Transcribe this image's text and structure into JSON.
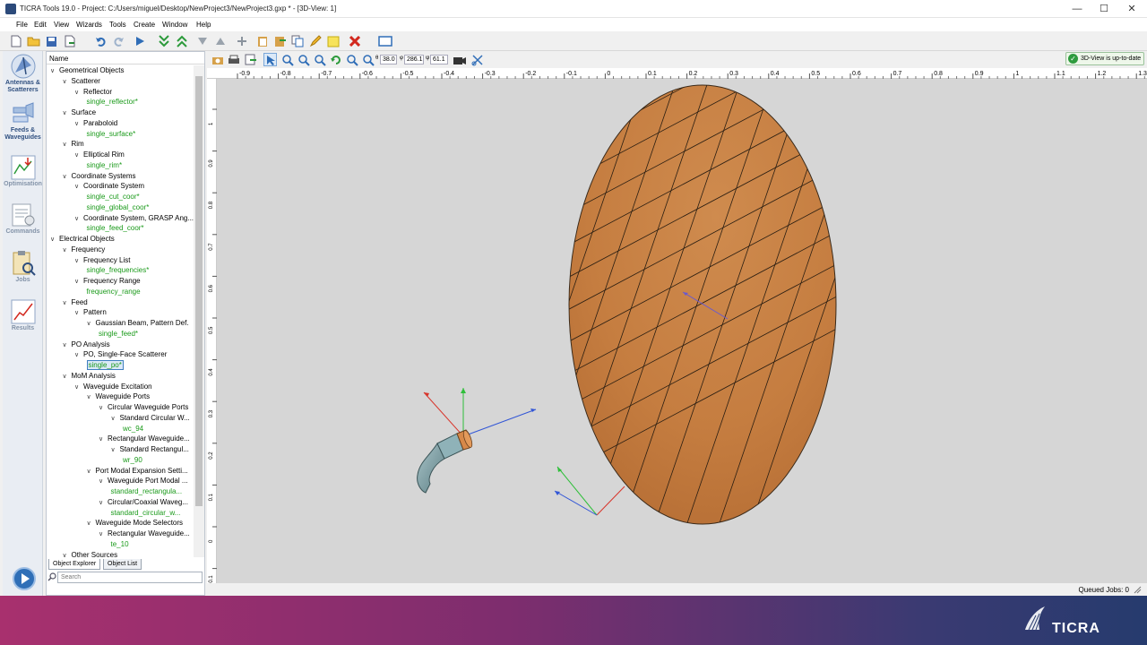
{
  "window": {
    "title": "TICRA Tools 19.0  - Project: C:/Users/miguel/Desktop/NewProject3/NewProject3.gxp * - [3D-View: 1]"
  },
  "menu": [
    "File",
    "Edit",
    "View",
    "Wizards",
    "Tools",
    "Create",
    "Window",
    "Help"
  ],
  "sidebar": [
    {
      "label": "Antennas & Scatterers",
      "icon": "antenna-icon"
    },
    {
      "label": "Feeds & Waveguides",
      "icon": "feed-icon"
    },
    {
      "label": "Optimisation",
      "icon": "optimisation-icon"
    },
    {
      "label": "Commands",
      "icon": "commands-icon"
    },
    {
      "label": "Jobs",
      "icon": "jobs-icon"
    },
    {
      "label": "Results",
      "icon": "results-icon"
    }
  ],
  "explorer": {
    "header": "Name",
    "tree": [
      {
        "text": "Geometrical Objects",
        "level": 0,
        "chev": true
      },
      {
        "text": "Scatterer",
        "level": 1,
        "chev": true
      },
      {
        "text": "Reflector",
        "level": 2,
        "chev": true
      },
      {
        "text": "single_reflector*",
        "level": 3,
        "leaf": true
      },
      {
        "text": "Surface",
        "level": 1,
        "chev": true
      },
      {
        "text": "Paraboloid",
        "level": 2,
        "chev": true
      },
      {
        "text": "single_surface*",
        "level": 3,
        "leaf": true
      },
      {
        "text": "Rim",
        "level": 1,
        "chev": true
      },
      {
        "text": "Elliptical Rim",
        "level": 2,
        "chev": true
      },
      {
        "text": "single_rim*",
        "level": 3,
        "leaf": true
      },
      {
        "text": "Coordinate Systems",
        "level": 1,
        "chev": true
      },
      {
        "text": "Coordinate System",
        "level": 2,
        "chev": true
      },
      {
        "text": "single_cut_coor*",
        "level": 3,
        "leaf": true
      },
      {
        "text": "single_global_coor*",
        "level": 3,
        "leaf": true
      },
      {
        "text": "Coordinate System, GRASP Ang...",
        "level": 2,
        "chev": true
      },
      {
        "text": "single_feed_coor*",
        "level": 3,
        "leaf": true
      },
      {
        "text": "Electrical Objects",
        "level": 0,
        "chev": true
      },
      {
        "text": "Frequency",
        "level": 1,
        "chev": true
      },
      {
        "text": "Frequency List",
        "level": 2,
        "chev": true
      },
      {
        "text": "single_frequencies*",
        "level": 3,
        "leaf": true
      },
      {
        "text": "Frequency Range",
        "level": 2,
        "chev": true
      },
      {
        "text": "frequency_range",
        "level": 3,
        "leaf": true
      },
      {
        "text": "Feed",
        "level": 1,
        "chev": true
      },
      {
        "text": "Pattern",
        "level": 2,
        "chev": true
      },
      {
        "text": "Gaussian Beam, Pattern Def.",
        "level": 3,
        "chev": true
      },
      {
        "text": "single_feed*",
        "level": 4,
        "leaf": true
      },
      {
        "text": "PO Analysis",
        "level": 1,
        "chev": true
      },
      {
        "text": "PO, Single-Face Scatterer",
        "level": 2,
        "chev": true
      },
      {
        "text": "single_po*",
        "level": 3,
        "leaf": true,
        "selected": true
      },
      {
        "text": "MoM Analysis",
        "level": 1,
        "chev": true
      },
      {
        "text": "Waveguide Excitation",
        "level": 2,
        "chev": true
      },
      {
        "text": "Waveguide Ports",
        "level": 3,
        "chev": true
      },
      {
        "text": "Circular Waveguide Ports",
        "level": 4,
        "chev": true
      },
      {
        "text": "Standard Circular W...",
        "level": 5,
        "chev": true
      },
      {
        "text": "wc_94",
        "level": 6,
        "leaf": true
      },
      {
        "text": "Rectangular Waveguide...",
        "level": 4,
        "chev": true
      },
      {
        "text": "Standard Rectangul...",
        "level": 5,
        "chev": true
      },
      {
        "text": "wr_90",
        "level": 6,
        "leaf": true
      },
      {
        "text": "Port Modal Expansion Setti...",
        "level": 3,
        "chev": true
      },
      {
        "text": "Waveguide Port Modal ...",
        "level": 4,
        "chev": true
      },
      {
        "text": "standard_rectangula...",
        "level": 5,
        "leaf": true
      },
      {
        "text": "Circular/Coaxial Waveg...",
        "level": 4,
        "chev": true
      },
      {
        "text": "standard_circular_w...",
        "level": 5,
        "leaf": true
      },
      {
        "text": "Waveguide Mode Selectors",
        "level": 3,
        "chev": true
      },
      {
        "text": "Rectangular Waveguide...",
        "level": 4,
        "chev": true
      },
      {
        "text": "te_10",
        "level": 5,
        "leaf": true
      },
      {
        "text": "Other Sources",
        "level": 1,
        "chev": true
      }
    ],
    "tabs": [
      "Object Explorer",
      "Object List"
    ],
    "search_placeholder": "Search"
  },
  "view_toolbar": {
    "theta": "38.0",
    "phi": "286.1",
    "psi": "61.1",
    "status": "3D-View is up-to-date"
  },
  "ruler": {
    "top": [
      "-0.9",
      "-0.8",
      "-0.7",
      "-0.6",
      "-0.5",
      "-0.4",
      "-0.3",
      "-0.2",
      "-0.1",
      "0",
      "0.1",
      "0.2",
      "0.3",
      "0.4",
      "0.5",
      "0.6",
      "0.7",
      "0.8",
      "0.9",
      "1",
      "1.1",
      "1.2",
      "1.3",
      "1.4"
    ],
    "left": [
      "1",
      "0.9",
      "0.8",
      "0.7",
      "0.6",
      "0.5",
      "0.4",
      "0.3",
      "0.2",
      "0.1",
      "0",
      "-0.1"
    ]
  },
  "statusbar": {
    "queued": "Queued Jobs: 0"
  },
  "brand": {
    "logo_text": "TICRA",
    "accent": "#cd8a4a"
  }
}
